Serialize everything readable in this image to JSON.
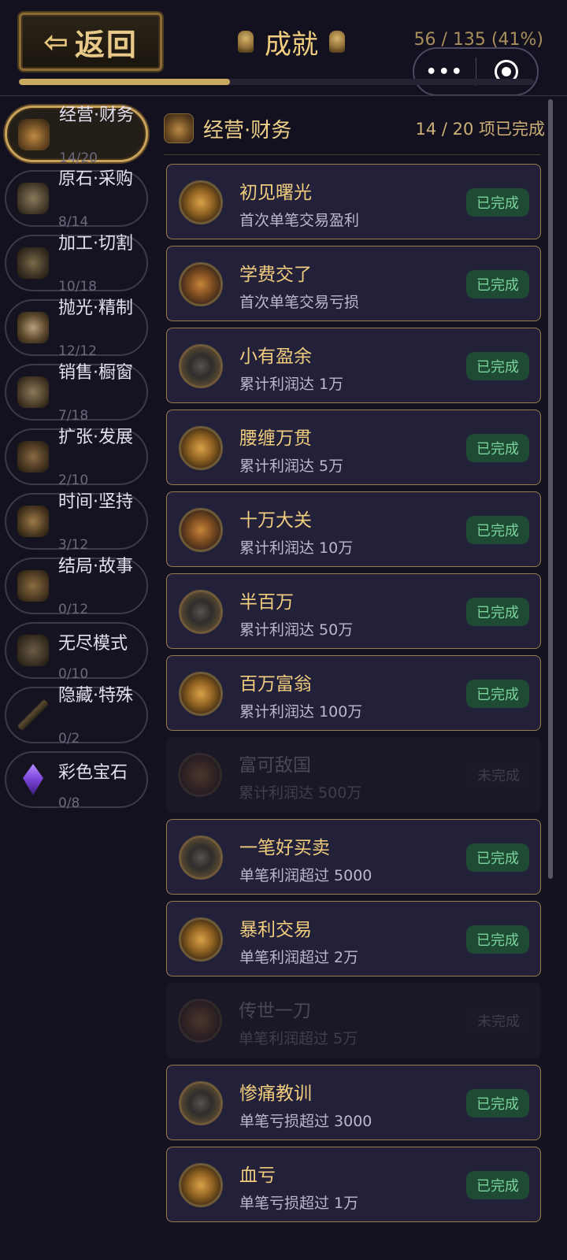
{
  "header": {
    "back_label": "返回",
    "title": "成就",
    "progress_text": "56 / 135 (41%)",
    "progress_fraction": 0.41,
    "capsule_more": "•••"
  },
  "sidebar": {
    "items": [
      {
        "label": "经营·财务",
        "count": "14/20",
        "icon": "money-bag-icon",
        "active": true
      },
      {
        "label": "原石·采购",
        "count": "8/14",
        "icon": "ore-icon",
        "active": false
      },
      {
        "label": "加工·切割",
        "count": "10/18",
        "icon": "cutting-icon",
        "active": false
      },
      {
        "label": "抛光·精制",
        "count": "12/12",
        "icon": "polish-icon",
        "active": false
      },
      {
        "label": "销售·橱窗",
        "count": "7/18",
        "icon": "shop-icon",
        "active": false
      },
      {
        "label": "扩张·发展",
        "count": "2/10",
        "icon": "growth-icon",
        "active": false
      },
      {
        "label": "时间·坚持",
        "count": "3/12",
        "icon": "hourglass-icon",
        "active": false
      },
      {
        "label": "结局·故事",
        "count": "0/12",
        "icon": "book-icon",
        "active": false
      },
      {
        "label": "无尽模式",
        "count": "0/10",
        "icon": "infinity-icon",
        "active": false
      },
      {
        "label": "隐藏·特殊",
        "count": "0/2",
        "icon": "key-icon",
        "active": false
      },
      {
        "label": "彩色宝石",
        "count": "0/8",
        "icon": "gem-icon",
        "active": false
      }
    ]
  },
  "section": {
    "title": "经营·财务",
    "progress": "14 / 20 项已完成",
    "icon": "money-bag-icon"
  },
  "achievements": [
    {
      "title": "初见曙光",
      "desc": "首次单笔交易盈利",
      "status": "已完成",
      "done": true,
      "medal": "gold-medal-icon"
    },
    {
      "title": "学费交了",
      "desc": "首次单笔交易亏损",
      "status": "已完成",
      "done": true,
      "medal": "chart-medal-icon"
    },
    {
      "title": "小有盈余",
      "desc": "累计利润达 1万",
      "status": "已完成",
      "done": true,
      "medal": "dark-medal-icon"
    },
    {
      "title": "腰缠万贯",
      "desc": "累计利润达 5万",
      "status": "已完成",
      "done": true,
      "medal": "gold-medal-icon"
    },
    {
      "title": "十万大关",
      "desc": "累计利润达 10万",
      "status": "已完成",
      "done": true,
      "medal": "chart-medal-icon"
    },
    {
      "title": "半百万",
      "desc": "累计利润达 50万",
      "status": "已完成",
      "done": true,
      "medal": "dark-medal-icon"
    },
    {
      "title": "百万富翁",
      "desc": "累计利润达 100万",
      "status": "已完成",
      "done": true,
      "medal": "gold-medal-icon"
    },
    {
      "title": "富可敌国",
      "desc": "累计利润达 500万",
      "status": "未完成",
      "done": false,
      "medal": "chart-medal-icon"
    },
    {
      "title": "一笔好买卖",
      "desc": "单笔利润超过 5000",
      "status": "已完成",
      "done": true,
      "medal": "dark-medal-icon"
    },
    {
      "title": "暴利交易",
      "desc": "单笔利润超过 2万",
      "status": "已完成",
      "done": true,
      "medal": "gold-medal-icon"
    },
    {
      "title": "传世一刀",
      "desc": "单笔利润超过 5万",
      "status": "未完成",
      "done": false,
      "medal": "chart-medal-icon"
    },
    {
      "title": "惨痛教训",
      "desc": "单笔亏损超过 3000",
      "status": "已完成",
      "done": true,
      "medal": "dark-medal-icon"
    },
    {
      "title": "血亏",
      "desc": "单笔亏损超过 1万",
      "status": "已完成",
      "done": true,
      "medal": "gold-medal-icon"
    }
  ],
  "colors": {
    "accent_gold": "#c9a85f",
    "done_badge_bg": "#1f4a33",
    "done_badge_text": "#79d39a",
    "background": "#13111f"
  }
}
